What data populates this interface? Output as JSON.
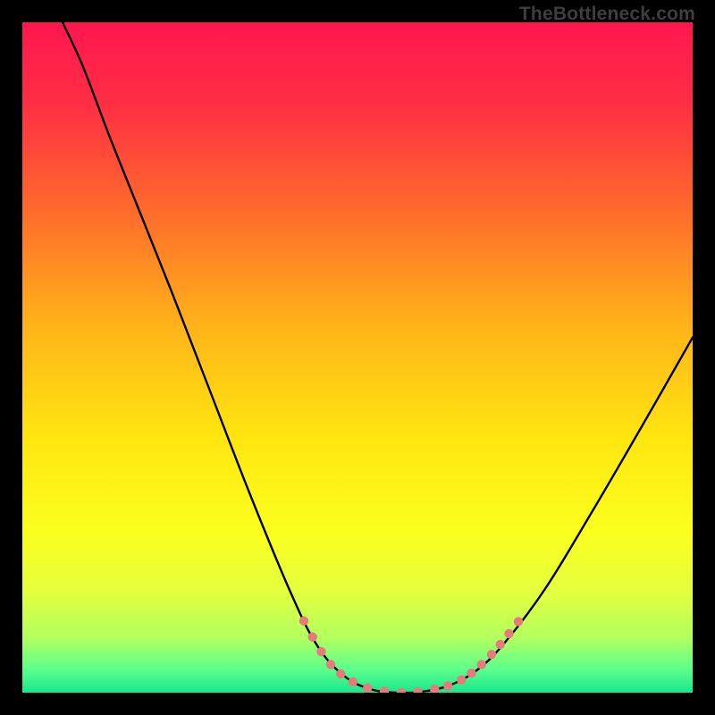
{
  "watermark": "TheBottleneck.com",
  "gradient": {
    "stops": [
      {
        "offset": 0.0,
        "color": "#ff1750"
      },
      {
        "offset": 0.12,
        "color": "#ff2e44"
      },
      {
        "offset": 0.28,
        "color": "#ff6a2c"
      },
      {
        "offset": 0.45,
        "color": "#ffb21a"
      },
      {
        "offset": 0.62,
        "color": "#ffe610"
      },
      {
        "offset": 0.76,
        "color": "#fbff1e"
      },
      {
        "offset": 0.85,
        "color": "#e4ff3e"
      },
      {
        "offset": 0.92,
        "color": "#b0ff60"
      },
      {
        "offset": 0.965,
        "color": "#5cff8c"
      },
      {
        "offset": 1.0,
        "color": "#17e88b"
      }
    ]
  },
  "chart_data": {
    "type": "line",
    "title": "",
    "xlabel": "",
    "ylabel": "",
    "xlim": [
      0,
      100
    ],
    "ylim": [
      0,
      100
    ],
    "series": [
      {
        "name": "bottleneck-curve",
        "points": [
          {
            "x": 6.0,
            "y": 100.0
          },
          {
            "x": 9.0,
            "y": 93.5
          },
          {
            "x": 13.0,
            "y": 83.0
          },
          {
            "x": 17.0,
            "y": 73.0
          },
          {
            "x": 22.0,
            "y": 60.5
          },
          {
            "x": 28.0,
            "y": 45.0
          },
          {
            "x": 34.0,
            "y": 29.5
          },
          {
            "x": 40.0,
            "y": 15.0
          },
          {
            "x": 44.0,
            "y": 7.0
          },
          {
            "x": 48.0,
            "y": 2.5
          },
          {
            "x": 52.0,
            "y": 0.5
          },
          {
            "x": 56.0,
            "y": 0.0
          },
          {
            "x": 60.0,
            "y": 0.2
          },
          {
            "x": 64.0,
            "y": 1.2
          },
          {
            "x": 68.0,
            "y": 3.5
          },
          {
            "x": 72.0,
            "y": 7.5
          },
          {
            "x": 78.0,
            "y": 15.5
          },
          {
            "x": 85.0,
            "y": 27.0
          },
          {
            "x": 92.0,
            "y": 39.0
          },
          {
            "x": 100.0,
            "y": 53.0
          }
        ]
      }
    ],
    "markers": {
      "name": "highlight-dots",
      "color": "#e77b7b",
      "points": [
        {
          "x": 42.0,
          "y": 10.7
        },
        {
          "x": 43.3,
          "y": 8.3
        },
        {
          "x": 44.6,
          "y": 6.1
        },
        {
          "x": 46.0,
          "y": 4.2
        },
        {
          "x": 47.5,
          "y": 2.8
        },
        {
          "x": 49.3,
          "y": 1.6
        },
        {
          "x": 51.5,
          "y": 0.7
        },
        {
          "x": 54.0,
          "y": 0.2
        },
        {
          "x": 56.5,
          "y": 0.0
        },
        {
          "x": 59.0,
          "y": 0.1
        },
        {
          "x": 61.5,
          "y": 0.5
        },
        {
          "x": 63.5,
          "y": 1.0
        },
        {
          "x": 65.5,
          "y": 1.9
        },
        {
          "x": 67.0,
          "y": 2.9
        },
        {
          "x": 68.5,
          "y": 4.2
        },
        {
          "x": 70.0,
          "y": 5.7
        },
        {
          "x": 71.3,
          "y": 7.2
        },
        {
          "x": 72.6,
          "y": 8.8
        },
        {
          "x": 74.0,
          "y": 10.6
        }
      ]
    }
  }
}
